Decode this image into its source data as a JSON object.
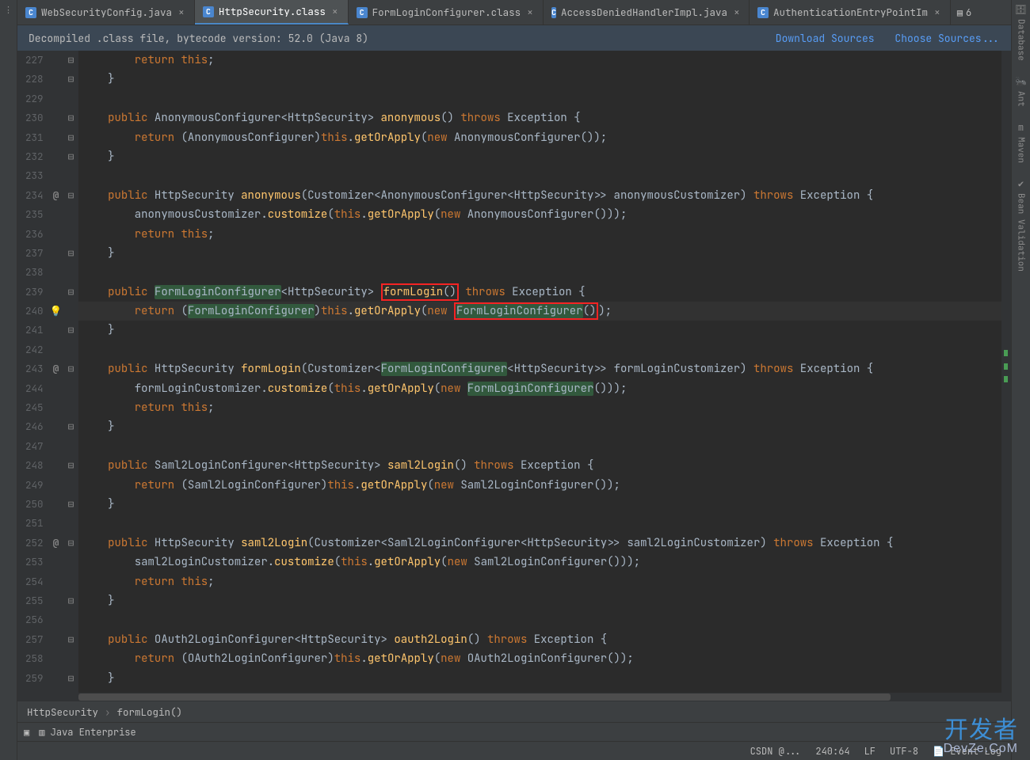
{
  "tabs": [
    {
      "icon": "C",
      "label": "WebSecurityConfig.java",
      "active": false
    },
    {
      "icon": "C",
      "label": "HttpSecurity.class",
      "active": true
    },
    {
      "icon": "C",
      "label": "FormLoginConfigurer.class",
      "active": false
    },
    {
      "icon": "C",
      "label": "AccessDeniedHandlerImpl.java",
      "active": false
    },
    {
      "icon": "C",
      "label": "AuthenticationEntryPointIm",
      "active": false
    }
  ],
  "tabs_more_badge": "6",
  "infobar": {
    "message": "Decompiled .class file, bytecode version: 52.0 (Java 8)",
    "link_download": "Download Sources",
    "link_choose": "Choose Sources..."
  },
  "right_panel": [
    {
      "icon": "🗄",
      "label": "Database"
    },
    {
      "icon": "🐜",
      "label": "Ant"
    },
    {
      "icon": "m",
      "label": "Maven"
    },
    {
      "icon": "✔",
      "label": "Bean Validation"
    }
  ],
  "gutter": {
    "start": 227,
    "end": 259,
    "override_marks": [
      234,
      243,
      252
    ],
    "fold_marks": [
      227,
      228,
      230,
      231,
      232,
      234,
      237,
      239,
      241,
      243,
      246,
      248,
      250,
      252,
      255,
      257,
      259
    ],
    "bulb_line": 240,
    "current_line": 240
  },
  "code_tokens": {
    "l227": "        return this;",
    "l228": "    }",
    "l229": "",
    "l230": "    public AnonymousConfigurer<HttpSecurity> anonymous() throws Exception {",
    "l231": "        return (AnonymousConfigurer)this.getOrApply(new AnonymousConfigurer());",
    "l232": "    }",
    "l233": "",
    "l234": "    public HttpSecurity anonymous(Customizer<AnonymousConfigurer<HttpSecurity>> anonymousCustomizer) throws Exception {",
    "l235": "        anonymousCustomizer.customize(this.getOrApply(new AnonymousConfigurer()));",
    "l236": "        return this;",
    "l237": "    }",
    "l238": "",
    "l239": "    public FormLoginConfigurer<HttpSecurity> formLogin() throws Exception {",
    "l240": "        return (FormLoginConfigurer)this.getOrApply(new FormLoginConfigurer());",
    "l241": "    }",
    "l242": "",
    "l243": "    public HttpSecurity formLogin(Customizer<FormLoginConfigurer<HttpSecurity>> formLoginCustomizer) throws Exception {",
    "l244": "        formLoginCustomizer.customize(this.getOrApply(new FormLoginConfigurer()));",
    "l245": "        return this;",
    "l246": "    }",
    "l247": "",
    "l248": "    public Saml2LoginConfigurer<HttpSecurity> saml2Login() throws Exception {",
    "l249": "        return (Saml2LoginConfigurer)this.getOrApply(new Saml2LoginConfigurer());",
    "l250": "    }",
    "l251": "",
    "l252": "    public HttpSecurity saml2Login(Customizer<Saml2LoginConfigurer<HttpSecurity>> saml2LoginCustomizer) throws Exception {",
    "l253": "        saml2LoginCustomizer.customize(this.getOrApply(new Saml2LoginConfigurer()));",
    "l254": "        return this;",
    "l255": "    }",
    "l256": "",
    "l257": "    public OAuth2LoginConfigurer<HttpSecurity> oauth2Login() throws Exception {",
    "l258": "        return (OAuth2LoginConfigurer)this.getOrApply(new OAuth2LoginConfigurer());",
    "l259": "    }"
  },
  "breadcrumbs": [
    "HttpSecurity",
    "formLogin()"
  ],
  "bottombar": {
    "terminal": "",
    "java_ee": "Java Enterprise"
  },
  "statusbar": {
    "pos": "240:64",
    "encoding": "LF",
    "charset": "UTF-8",
    "event": "Event Log",
    "csdn": "CSDN @..."
  },
  "watermark": {
    "cn": "开发者",
    "en": "DevZe.CoM"
  },
  "colors": {
    "keyword": "#cc7832",
    "method": "#ffc66d",
    "bg": "#2b2b2b",
    "gutter": "#313335",
    "annotation_box": "#f52323",
    "usage_hl": "#32593d"
  }
}
